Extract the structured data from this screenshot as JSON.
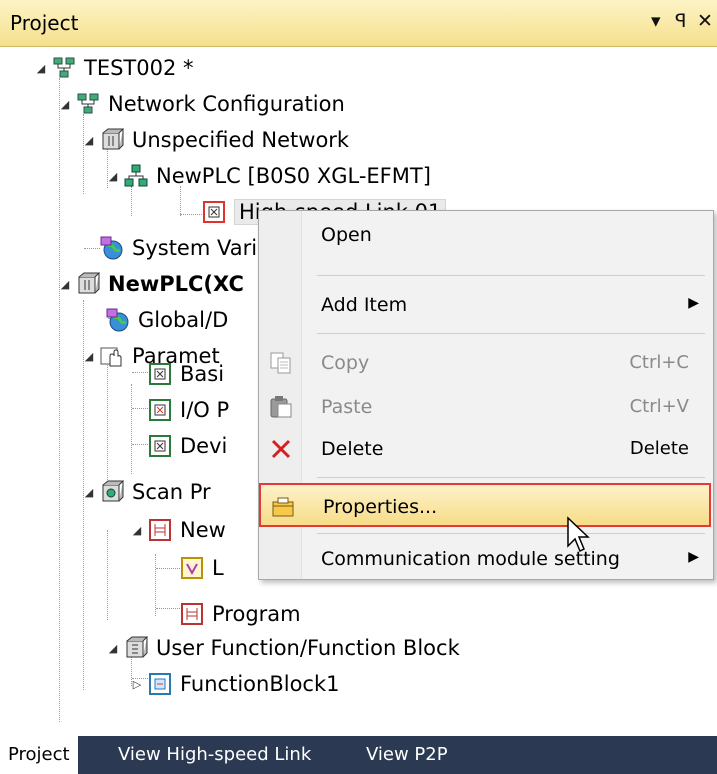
{
  "panel": {
    "title": "Project",
    "controls": [
      "▾",
      "ꟼ",
      "✕"
    ]
  },
  "tree": [
    {
      "label": "TEST002 *",
      "icon": "network-config-icon",
      "expanded": true
    },
    {
      "label": "Network Configuration",
      "icon": "network-config-icon",
      "expanded": true
    },
    {
      "label": "Unspecified Network",
      "icon": "network-box-icon",
      "expanded": true
    },
    {
      "label": "NewPLC [B0S0 XGL-EFMT]",
      "icon": "plc-network-icon",
      "expanded": true
    },
    {
      "label": "High-speed Link 01",
      "icon": "highspeed-link-icon",
      "selected": true
    },
    {
      "label": "System Vari",
      "icon": "globe-icon"
    },
    {
      "label": "NewPLC(XC",
      "icon": "cpu-box-icon",
      "expanded": true,
      "bold": true
    },
    {
      "label": "Global/D",
      "icon": "globe-icon"
    },
    {
      "label": "Paramet",
      "icon": "hand-params-icon",
      "expanded": true
    },
    {
      "label": "Basi",
      "icon": "param-box-icon"
    },
    {
      "label": "I/O P",
      "icon": "io-param-icon"
    },
    {
      "label": "Devi",
      "icon": "param-box-icon"
    },
    {
      "label": "Scan Pr",
      "icon": "scan-program-icon",
      "expanded": true
    },
    {
      "label": "New",
      "icon": "ladder-icon",
      "expanded": true
    },
    {
      "label": "L",
      "icon": "local-var-icon"
    },
    {
      "label": "Program",
      "icon": "ladder-icon"
    },
    {
      "label": "User Function/Function Block",
      "icon": "function-folder-icon",
      "expanded": true
    },
    {
      "label": "FunctionBlock1",
      "icon": "function-block-icon",
      "collapsed": true
    }
  ],
  "context_menu": {
    "items": [
      {
        "label": "Open",
        "shortcut": "",
        "disabled": false
      },
      {
        "label": "Add Item",
        "shortcut": "",
        "submenu": true
      },
      {
        "label": "Copy",
        "shortcut": "Ctrl+C",
        "disabled": true
      },
      {
        "label": "Paste",
        "shortcut": "Ctrl+V",
        "disabled": true
      },
      {
        "label": "Delete",
        "shortcut": "Delete",
        "disabled": false
      },
      {
        "label": "Properties...",
        "shortcut": "",
        "hovered": true
      },
      {
        "label": "Communication module setting",
        "shortcut": "",
        "submenu": true
      }
    ]
  },
  "bottom_tabs": [
    "Project",
    "View High-speed Link",
    "View P2P"
  ],
  "colors": {
    "titlebar": "#f5e08c",
    "highlight_border": "#e53935",
    "statusbar": "#2b3a52"
  }
}
